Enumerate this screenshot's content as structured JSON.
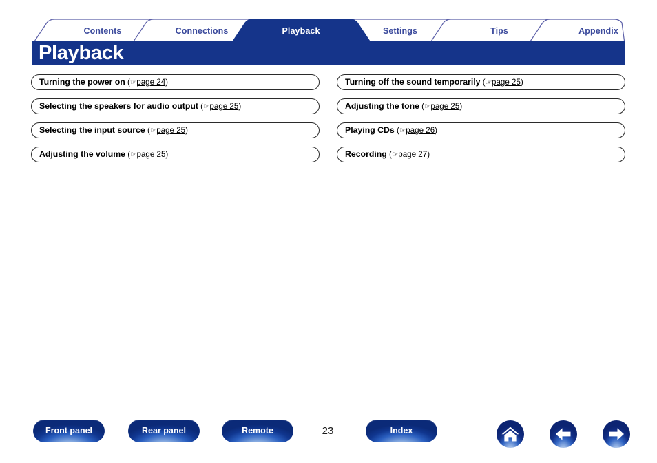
{
  "tabs": [
    {
      "label": "Contents",
      "active": false
    },
    {
      "label": "Connections",
      "active": false
    },
    {
      "label": "Playback",
      "active": true
    },
    {
      "label": "Settings",
      "active": false
    },
    {
      "label": "Tips",
      "active": false
    },
    {
      "label": "Appendix",
      "active": false
    }
  ],
  "header": {
    "title": "Playback"
  },
  "links": {
    "left": [
      {
        "title": "Turning the power on",
        "hand": "☞",
        "page": "page 24"
      },
      {
        "title": "Selecting the speakers for audio output",
        "hand": "☞",
        "page": "page 25"
      },
      {
        "title": "Selecting the input source",
        "hand": "☞",
        "page": "page 25"
      },
      {
        "title": "Adjusting the volume",
        "hand": "☞",
        "page": "page 25"
      }
    ],
    "right": [
      {
        "title": "Turning off the sound temporarily",
        "hand": "☞",
        "page": "page 25"
      },
      {
        "title": "Adjusting the tone",
        "hand": "☞",
        "page": "page 25"
      },
      {
        "title": "Playing CDs",
        "hand": "☞",
        "page": "page 26"
      },
      {
        "title": "Recording",
        "hand": "☞",
        "page": "page 27"
      }
    ]
  },
  "footer": {
    "buttons": [
      {
        "label": "Front panel"
      },
      {
        "label": "Rear panel"
      },
      {
        "label": "Remote"
      },
      {
        "label": "Index"
      }
    ],
    "page_number": "23",
    "icons": [
      {
        "name": "home-icon",
        "title": "Home"
      },
      {
        "name": "back-icon",
        "title": "Previous page"
      },
      {
        "name": "next-icon",
        "title": "Next page"
      }
    ]
  },
  "colors": {
    "brand_navy": "#15348a",
    "tab_text": "#3b4a9c",
    "tab_active_text": "#ffffff",
    "box_border": "#2b2b2b",
    "page_bg": "#ffffff"
  }
}
